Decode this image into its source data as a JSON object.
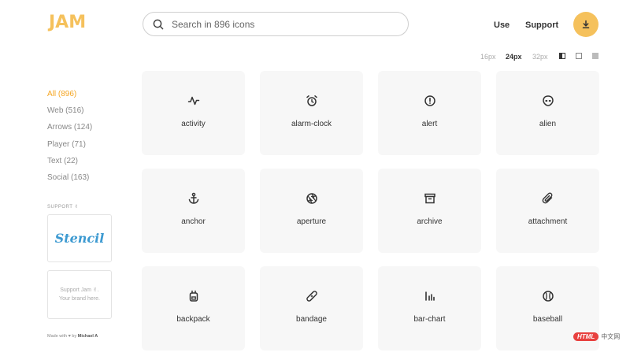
{
  "app": {
    "logo": "JAM"
  },
  "search": {
    "placeholder": "Search in 896 icons"
  },
  "nav": {
    "use": "Use",
    "support": "Support"
  },
  "sizes": [
    {
      "label": "16px",
      "active": false
    },
    {
      "label": "24px",
      "active": true
    },
    {
      "label": "32px",
      "active": false
    }
  ],
  "categories": [
    {
      "label": "All (896)",
      "active": true
    },
    {
      "label": "Web (516)",
      "active": false
    },
    {
      "label": "Arrows (124)",
      "active": false
    },
    {
      "label": "Player (71)",
      "active": false
    },
    {
      "label": "Text (22)",
      "active": false
    },
    {
      "label": "Social (163)",
      "active": false
    }
  ],
  "support": {
    "label": "SUPPORT ✌",
    "sponsor": "Stencil",
    "ad_line1": "Support Jam ✌.",
    "ad_line2": "Your brand here."
  },
  "footer": {
    "made_with": "Made with ♥ by",
    "author": "Michael A"
  },
  "icons": [
    {
      "name": "activity",
      "icon": "activity-icon"
    },
    {
      "name": "alarm-clock",
      "icon": "alarm-clock-icon"
    },
    {
      "name": "alert",
      "icon": "alert-icon"
    },
    {
      "name": "alien",
      "icon": "alien-icon"
    },
    {
      "name": "anchor",
      "icon": "anchor-icon"
    },
    {
      "name": "aperture",
      "icon": "aperture-icon"
    },
    {
      "name": "archive",
      "icon": "archive-icon"
    },
    {
      "name": "attachment",
      "icon": "attachment-icon"
    },
    {
      "name": "backpack",
      "icon": "backpack-icon"
    },
    {
      "name": "bandage",
      "icon": "bandage-icon"
    },
    {
      "name": "bar-chart",
      "icon": "bar-chart-icon"
    },
    {
      "name": "baseball",
      "icon": "baseball-icon"
    }
  ],
  "watermark": {
    "badge": "HTML",
    "text": "中文网"
  },
  "colors": {
    "accent": "#f5c15c",
    "active_category": "#f5a623",
    "card_bg": "#f7f7f7"
  }
}
